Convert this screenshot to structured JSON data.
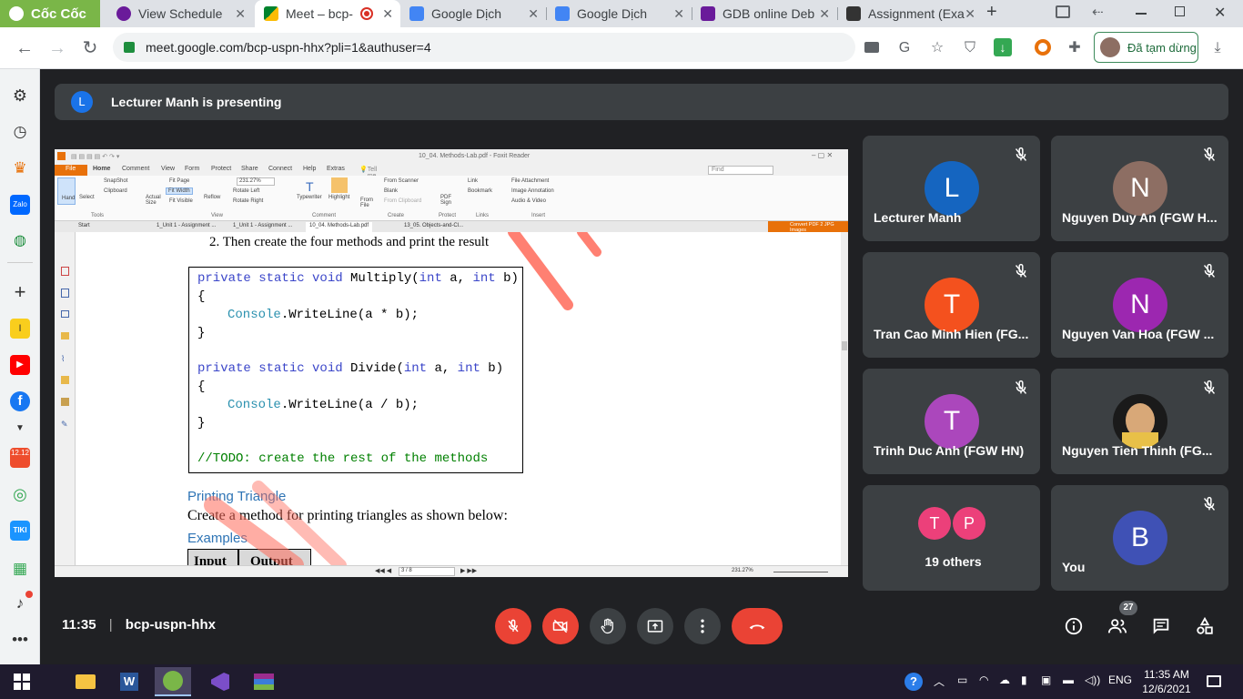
{
  "browser": {
    "tabs": [
      {
        "label": "Cốc Cốc",
        "icon": "coccoc-icon"
      },
      {
        "label": "View Schedule",
        "icon": "schedule-icon"
      },
      {
        "label": "Meet – bcp-",
        "icon": "meet-icon",
        "active": true
      },
      {
        "label": "Google Dịch",
        "icon": "translate-icon"
      },
      {
        "label": "Google Dịch",
        "icon": "translate-icon"
      },
      {
        "label": "GDB online Deb",
        "icon": "gdb-icon"
      },
      {
        "label": "Assignment (Exa",
        "icon": "assignment-icon"
      }
    ],
    "new_tab": "+",
    "url": "meet.google.com/bcp-uspn-hhx?pli=1&authuser=4",
    "profile_status": "Đã tạm dừng"
  },
  "meet": {
    "banner": {
      "avatar_letter": "L",
      "text": "Lecturer Manh is presenting"
    },
    "meeting_time": "11:35",
    "meeting_code": "bcp-uspn-hhx",
    "participant_count": "27",
    "participants": [
      {
        "name": "Lecturer Manh",
        "letter": "L",
        "color": "#1565c0"
      },
      {
        "name": "Nguyen Duy An (FGW H...",
        "letter": "N",
        "color": "#8d6e63"
      },
      {
        "name": "Tran Cao Minh Hien (FG...",
        "letter": "T",
        "color": "#f4511e"
      },
      {
        "name": "Nguyen Van Hoa (FGW ...",
        "letter": "N",
        "color": "#9c27b0"
      },
      {
        "name": "Trinh Duc Anh (FGW HN)",
        "letter": "T",
        "color": "#ab47bc"
      },
      {
        "name": "Nguyen Tien Thinh (FG...",
        "letter": "",
        "color": "#5d4037"
      },
      {
        "name": "19 others",
        "letters": [
          "T",
          "P"
        ],
        "colors": [
          "#ec407a",
          "#ec407a"
        ]
      },
      {
        "name": "You",
        "letter": "B",
        "color": "#3f51b5"
      }
    ]
  },
  "foxit": {
    "title": "10_04. Methods-Lab.pdf - Foxit Reader",
    "menu": [
      "File",
      "Home",
      "Comment",
      "View",
      "Form",
      "Protect",
      "Share",
      "Connect",
      "Help",
      "Extras"
    ],
    "tell_me": "Tell me what you want to",
    "find_placeholder": "Find",
    "ribbon": {
      "hand": "Hand",
      "select": "Select",
      "snapshot": "SnapShot",
      "clipboard": "Clipboard",
      "actual_size": "Actual Size",
      "fit_page": "Fit Page",
      "fit_width": "Fit Width",
      "fit_visible": "Fit Visible",
      "reflow": "Reflow",
      "zoom": "231.27%",
      "rotate_left": "Rotate Left",
      "rotate_right": "Rotate Right",
      "typewriter": "Typewriter",
      "highlight": "Highlight",
      "from_file": "From File",
      "from_scanner": "From Scanner",
      "blank": "Blank",
      "from_clipboard": "From Clipboard",
      "pdf_sign": "PDF Sign",
      "link": "Link",
      "bookmark": "Bookmark",
      "file_attachment": "File Attachment",
      "image_annotation": "Image Annotation",
      "audio_video": "Audio & Video",
      "groups": [
        "Tools",
        "View",
        "Comment",
        "Create",
        "Protect",
        "Links",
        "Insert"
      ]
    },
    "doc_tabs": [
      "Start",
      "1_Unit 1 - Assignment ...",
      "1_Unit 1 - Assignment ...",
      "10_04. Methods-Lab.pdf",
      "13_05. Objects-and-Cl..."
    ],
    "convert_banner": "Convert PDF 2 JPG Images",
    "page_indicator": "3 / 8",
    "zoom_status": "231.27%"
  },
  "document": {
    "heading": "2.   Then create the four methods and print the result",
    "code": {
      "l1_kw": "private static void ",
      "l1_rest": "Multiply(",
      "l1_int1": "int",
      "l1_a": " a, ",
      "l1_int2": "int",
      "l1_b": " b)",
      "open1": "{",
      "l3_cls": "Console",
      "l3_rest": ".WriteLine(a * b);",
      "close1": "}",
      "l6_kw": "private static void ",
      "l6_rest": "Divide(",
      "l6_int1": "int",
      "l6_a": " a, ",
      "l6_int2": "int",
      "l6_b": " b)",
      "open2": "{",
      "l8_cls": "Console",
      "l8_rest": ".WriteLine(a / b);",
      "close2": "}",
      "todo": "//TODO: create the rest of the methods"
    },
    "section_title": "Printing Triangle",
    "body_text": "Create a method for printing triangles as shown below:",
    "examples_title": "Examples",
    "table_headers": [
      "Input",
      "Output"
    ]
  },
  "taskbar": {
    "time": "11:35 AM",
    "date": "12/6/2021",
    "lang": "ENG",
    "apps": [
      "windows-start",
      "file-explorer",
      "word",
      "coccoc",
      "visual-studio",
      "winrar"
    ]
  },
  "sidebar": {
    "badge": "12.12",
    "tiki": "TIKI"
  },
  "colors": {
    "meet_bg": "#202124",
    "tile_bg": "#3c4043",
    "end_call": "#ea4335",
    "watermark": "#ff6b5a"
  }
}
